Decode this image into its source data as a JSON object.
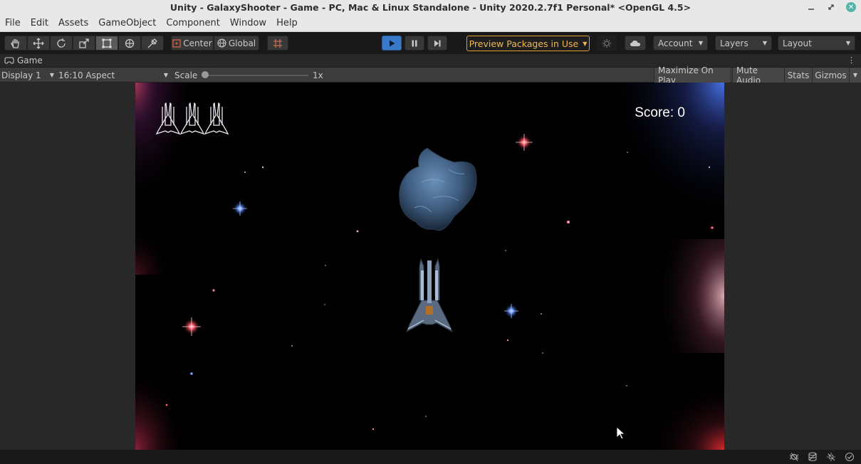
{
  "window": {
    "title": "Unity - GalaxyShooter - Game - PC, Mac & Linux Standalone - Unity 2020.2.7f1 Personal* <OpenGL 4.5>"
  },
  "menu": {
    "items": [
      "File",
      "Edit",
      "Assets",
      "GameObject",
      "Component",
      "Window",
      "Help"
    ]
  },
  "toolbar": {
    "pivot_label": "Center",
    "space_label": "Global",
    "preview_label": "Preview Packages in Use",
    "account_label": "Account",
    "layers_label": "Layers",
    "layout_label": "Layout"
  },
  "game_tab": {
    "label": "Game"
  },
  "game_bar": {
    "display_label": "Display 1",
    "aspect_label": "16:10 Aspect",
    "scale_label": "Scale",
    "scale_value": "1x",
    "maximize_label": "Maximize On Play",
    "mute_label": "Mute Audio",
    "stats_label": "Stats",
    "gizmos_label": "Gizmos"
  },
  "game": {
    "score_text": "Score: 0",
    "lives": 3
  },
  "colors": {
    "accent_warning": "#f0b84a",
    "play_active": "#3a79c8"
  },
  "icons": {
    "tools": [
      "hand-icon",
      "move-icon",
      "rotate-icon",
      "scale-icon",
      "rect-icon",
      "transform-icon",
      "custom-tool-icon"
    ]
  }
}
